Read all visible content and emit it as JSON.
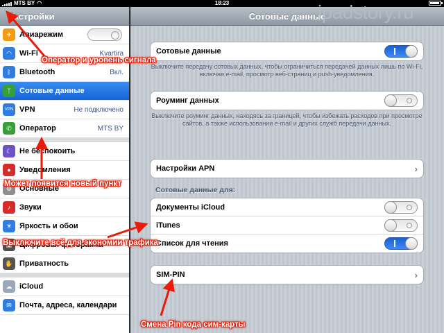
{
  "statusbar": {
    "carrier": "MTS BY",
    "time": "18:23"
  },
  "watermark": "ipadstory.ru",
  "sidebar": {
    "title": "Настройки",
    "items": [
      {
        "label": "Авиарежим",
        "value": "",
        "icon": "airplane-icon",
        "color": "#f39c12"
      },
      {
        "label": "Wi-Fi",
        "value": "Kvartira",
        "icon": "wifi-icon",
        "color": "#2f7de1"
      },
      {
        "label": "Bluetooth",
        "value": "Вкл.",
        "icon": "bluetooth-icon",
        "color": "#2f7de1"
      },
      {
        "label": "Сотовые данные",
        "value": "",
        "icon": "antenna-icon",
        "color": "#36a038"
      },
      {
        "label": "VPN",
        "value": "Не подключено",
        "icon": "vpn-icon",
        "color": "#2f7de1"
      },
      {
        "label": "Оператор",
        "value": "MTS BY",
        "icon": "phone-icon",
        "color": "#36a038"
      },
      {
        "label": "Не беспокоить",
        "value": "",
        "icon": "moon-icon",
        "color": "#6d52c8"
      },
      {
        "label": "Уведомления",
        "value": "",
        "icon": "notifications-icon",
        "color": "#d42b2b"
      },
      {
        "label": "Основные",
        "value": "",
        "icon": "gear-icon",
        "color": "#8e8e93"
      },
      {
        "label": "Звуки",
        "value": "",
        "icon": "speaker-icon",
        "color": "#d42b2b"
      },
      {
        "label": "Яркость и обои",
        "value": "",
        "icon": "brightness-icon",
        "color": "#2f7de1"
      },
      {
        "label": "Цифровая фоторамка",
        "value": "",
        "icon": "photo-frame-icon",
        "color": "#4d4d4d"
      },
      {
        "label": "Приватность",
        "value": "",
        "icon": "hand-icon",
        "color": "#555555"
      },
      {
        "label": "iCloud",
        "value": "",
        "icon": "cloud-icon",
        "color": "#9aa8b8"
      },
      {
        "label": "Почта, адреса, календари",
        "value": "",
        "icon": "mail-icon",
        "color": "#2f7de1"
      }
    ]
  },
  "main": {
    "title": "Сотовые данные",
    "cellular_label": "Сотовые данные",
    "cellular_on": true,
    "cellular_note": "Выключите передачу сотовых данных, чтобы ограничиться передачей данных лишь по Wi-Fi, включая e-mail, просмотр веб-страниц и push-уведомления.",
    "roaming_label": "Роуминг данных",
    "roaming_on": false,
    "roaming_note": "Выключите роуминг данных, находясь за границей, чтобы избежать расходов при просмотре сайтов, а также использовании e-mail и других служб передачи данных.",
    "apn_label": "Настройки APN",
    "group_label": "Сотовые данные для:",
    "apps": [
      {
        "label": "Документы iCloud",
        "on": false
      },
      {
        "label": "iTunes",
        "on": false
      },
      {
        "label": "Список для чтения",
        "on": true
      }
    ],
    "simpin_label": "SIM-PIN"
  },
  "annotations": {
    "operator": "Оператор и уровень сигнала",
    "new_item": "Может появится новый пункт",
    "disable_all": "Выключите всё для экономии трафика",
    "sim_pin": "Смена Pin кода сим-карты",
    "color": "#e81c08"
  }
}
